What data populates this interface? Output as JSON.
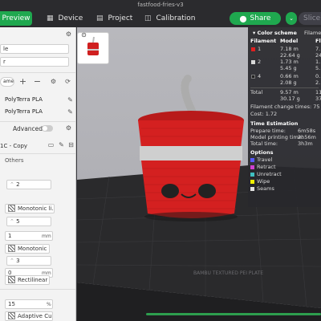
{
  "window": {
    "title": "fastfood-fries-v3"
  },
  "tabs": [
    {
      "label": "Preview",
      "icon": "eye-icon"
    },
    {
      "label": "Device",
      "icon": "grid-icon"
    },
    {
      "label": "Project",
      "icon": "document-icon"
    },
    {
      "label": "Calibration",
      "icon": "calibration-icon"
    }
  ],
  "header": {
    "share_label": "Share",
    "slice_label": "Slice pl"
  },
  "left": {
    "field_profile": "le",
    "field_profile2": "r",
    "plates_label": "ames",
    "filaments": [
      "PolyTerra PLA",
      "PolyTerra PLA"
    ],
    "advanced_label": "Advanced",
    "process_name": "1C - Copy",
    "others_label": "Others",
    "v_walls": "2",
    "top_pattern": "Monotonic li...",
    "top_layers": "5",
    "thickness": "1",
    "thickness_unit": "mm",
    "bottom_pattern": "Monotonic",
    "bottom_layers": "3",
    "bottom_thickness": "0",
    "bottom_unit": "mm",
    "internal_pattern": "Rectilinear",
    "infill_density": "15",
    "infill_unit": "%",
    "infill_pattern": "Adaptive Cu..."
  },
  "legend": {
    "color_scheme_label": "Color scheme",
    "filament_tab_label": "Filame",
    "columns": [
      "Filament",
      "Model",
      "Fl"
    ],
    "rows": [
      {
        "id": "1",
        "model_len": "7.18 m",
        "model_wt": "22.64 g",
        "flush_len": "7.",
        "flush_wt": "24",
        "color": "#e02020"
      },
      {
        "id": "2",
        "model_len": "1.73 m",
        "model_wt": "5.45 g",
        "flush_len": "1.",
        "flush_wt": "5.",
        "color": "#d9d9d9"
      },
      {
        "id": "4",
        "model_len": "0.66 m",
        "model_wt": "2.08 g",
        "flush_len": "0.",
        "flush_wt": "2.",
        "color": "#222222"
      }
    ],
    "total_label": "Total",
    "total_len": "9.57 m",
    "total_wt": "30.17 g",
    "total_flush_len": "11",
    "total_flush_wt": "37",
    "filament_change": "Filament change times: 75",
    "cost": "Cost: 1.72",
    "time_est_label": "Time Estimation",
    "prepare_label": "Prepare time:",
    "prepare_value": "6m58s",
    "model_time_label": "Model printing time:",
    "model_time_value": "2h56m",
    "total_time_label": "Total time:",
    "total_time_value": "3h3m",
    "options_label": "Options",
    "options": [
      {
        "label": "Travel",
        "color": "#5a5aff"
      },
      {
        "label": "Retract",
        "color": "#d040d0"
      },
      {
        "label": "Unretract",
        "color": "#40c0c0"
      },
      {
        "label": "Wipe",
        "color": "#f0f000"
      },
      {
        "label": "Seams",
        "color": "#e0e0e0"
      }
    ]
  },
  "plate_label": "BAMBU TEXTURED PEI PLATE"
}
